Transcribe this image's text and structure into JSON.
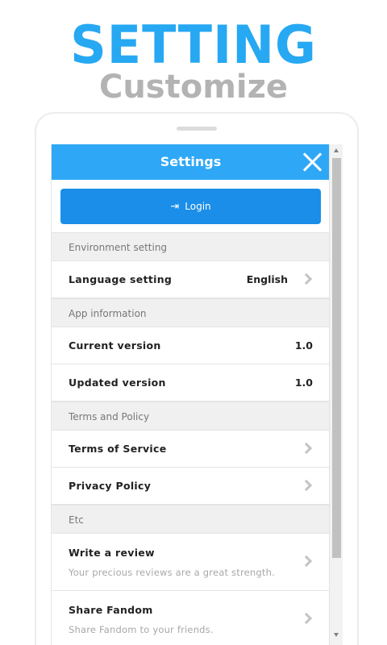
{
  "promo": {
    "headline": "SETTING",
    "subheadline": "Customize"
  },
  "header": {
    "title": "Settings",
    "close_icon": "close-icon"
  },
  "login": {
    "label": "Login",
    "icon": "login-icon"
  },
  "sections": {
    "environment": {
      "title": "Environment setting",
      "items": [
        {
          "label": "Language setting",
          "value": "English"
        }
      ]
    },
    "app_info": {
      "title": "App information",
      "items": [
        {
          "label": "Current version",
          "value": "1.0"
        },
        {
          "label": "Updated version",
          "value": "1.0"
        }
      ]
    },
    "terms": {
      "title": "Terms and Policy",
      "items": [
        {
          "label": "Terms of Service"
        },
        {
          "label": "Privacy Policy"
        }
      ]
    },
    "etc": {
      "title": "Etc",
      "items": [
        {
          "label": "Write a review",
          "sub": "Your precious reviews are a great strength."
        },
        {
          "label": "Share Fandom",
          "sub": "Share Fandom to your friends."
        }
      ]
    }
  },
  "colors": {
    "accent": "#2ea8f6",
    "login_button": "#1a8ee8",
    "headline": "#27a8f2",
    "subheadline": "#b3b3b3"
  }
}
